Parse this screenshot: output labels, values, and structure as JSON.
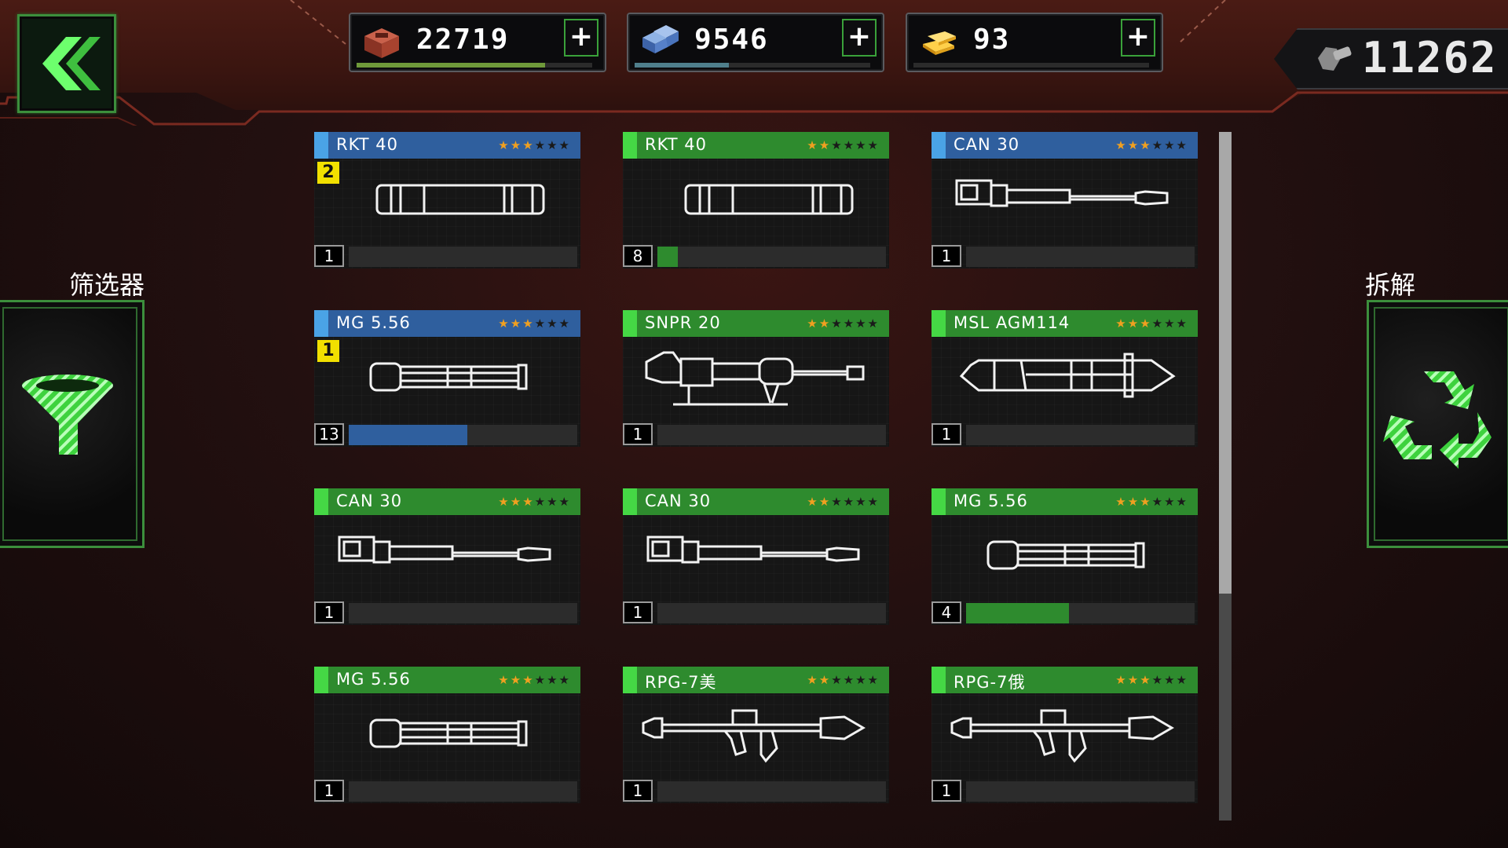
{
  "resources": [
    {
      "icon": "crate-icon",
      "value": "22719",
      "bar_fill": 0.8,
      "bar_color": "#6f9a3a",
      "plus_label": "+"
    },
    {
      "icon": "blue-crates-icon",
      "value": "9546",
      "bar_fill": 0.4,
      "bar_color": "#4f7f8c",
      "plus_label": "+"
    },
    {
      "icon": "gold-bars-icon",
      "value": "93",
      "bar_fill": 0.0,
      "bar_color": "#8a8a8a",
      "plus_label": "+"
    }
  ],
  "bolts": {
    "icon": "bolt-icon",
    "value": "11262"
  },
  "filter": {
    "label": "筛选器",
    "icon": "funnel-icon"
  },
  "dismantle": {
    "label": "拆解",
    "icon": "recycle-icon"
  },
  "scroll": {
    "position": 0.0,
    "visible_fraction": 0.67
  },
  "colors": {
    "blue_title": "#2f5f9e",
    "green_title": "#2e8b2e",
    "blue_accent": "#4aa3e6",
    "green_accent": "#45d845",
    "star_on": "#f0a020",
    "star_off": "#1a1a1a"
  },
  "cards": [
    {
      "name": "RKT 40",
      "rarity": "blue",
      "stars": 3,
      "stars_total": 6,
      "badge": "2",
      "count": "1",
      "progress": 0.0,
      "art": "rocket-pod-icon"
    },
    {
      "name": "RKT 40",
      "rarity": "green",
      "stars": 2,
      "stars_total": 6,
      "badge": "",
      "count": "8",
      "progress": 0.09,
      "art": "rocket-pod-icon"
    },
    {
      "name": "CAN 30",
      "rarity": "blue",
      "stars": 3,
      "stars_total": 6,
      "badge": "",
      "count": "1",
      "progress": 0.0,
      "art": "cannon-icon"
    },
    {
      "name": "MG 5.56",
      "rarity": "blue",
      "stars": 3,
      "stars_total": 6,
      "badge": "1",
      "count": "13",
      "progress": 0.52,
      "art": "minigun-icon"
    },
    {
      "name": "SNPR 20",
      "rarity": "green",
      "stars": 2,
      "stars_total": 6,
      "badge": "",
      "count": "1",
      "progress": 0.0,
      "art": "sniper-icon"
    },
    {
      "name": "MSL AGM114",
      "rarity": "green",
      "stars": 3,
      "stars_total": 6,
      "badge": "",
      "count": "1",
      "progress": 0.0,
      "art": "missile-icon"
    },
    {
      "name": "CAN 30",
      "rarity": "green",
      "stars": 3,
      "stars_total": 6,
      "badge": "",
      "count": "1",
      "progress": 0.0,
      "art": "cannon-icon"
    },
    {
      "name": "CAN 30",
      "rarity": "green",
      "stars": 2,
      "stars_total": 6,
      "badge": "",
      "count": "1",
      "progress": 0.0,
      "art": "cannon-icon"
    },
    {
      "name": "MG 5.56",
      "rarity": "green",
      "stars": 3,
      "stars_total": 6,
      "badge": "",
      "count": "4",
      "progress": 0.45,
      "art": "minigun-icon"
    },
    {
      "name": "MG 5.56",
      "rarity": "green",
      "stars": 3,
      "stars_total": 6,
      "badge": "",
      "count": "1",
      "progress": 0.0,
      "art": "minigun-icon"
    },
    {
      "name": "RPG-7美",
      "rarity": "green",
      "stars": 2,
      "stars_total": 6,
      "badge": "",
      "count": "1",
      "progress": 0.0,
      "art": "rpg-icon"
    },
    {
      "name": "RPG-7俄",
      "rarity": "green",
      "stars": 3,
      "stars_total": 6,
      "badge": "",
      "count": "1",
      "progress": 0.0,
      "art": "rpg-icon"
    }
  ]
}
